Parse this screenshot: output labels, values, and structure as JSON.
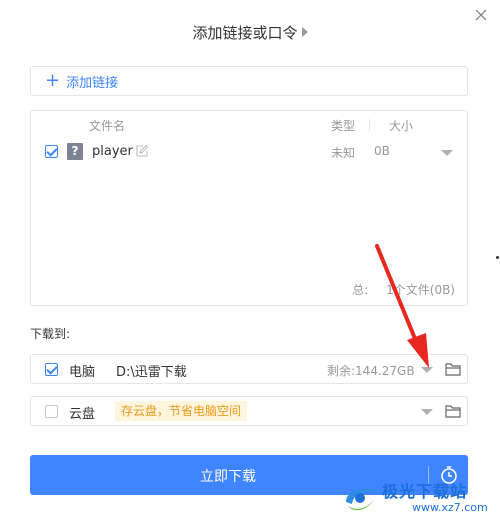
{
  "dialog": {
    "title": "添加链接或口令",
    "add_link_label": "添加链接"
  },
  "file_list": {
    "headers": {
      "name": "文件名",
      "type": "类型",
      "size": "大小"
    },
    "rows": [
      {
        "checked": true,
        "icon": "unknown-file-icon",
        "icon_glyph": "?",
        "name": "player",
        "type": "未知",
        "size": "0B"
      }
    ],
    "summary_label": "总:",
    "summary_value": "1个文件(0B)"
  },
  "download_to": {
    "label": "下载到:",
    "pc": {
      "checked": true,
      "name": "电脑",
      "path": "D:\\迅雷下载",
      "free": "剩余:144.27GB"
    },
    "cloud": {
      "checked": false,
      "name": "云盘",
      "promo": "存云盘，节省电脑空间"
    }
  },
  "download_button": {
    "label": "立即下载"
  },
  "watermark": {
    "text": "极光下载站",
    "url": "www.xz7.com"
  },
  "colors": {
    "accent": "#3f85ff",
    "promo_bg": "#fff4dc",
    "promo_text": "#e89a1a",
    "annotation_arrow": "#e8281e"
  }
}
